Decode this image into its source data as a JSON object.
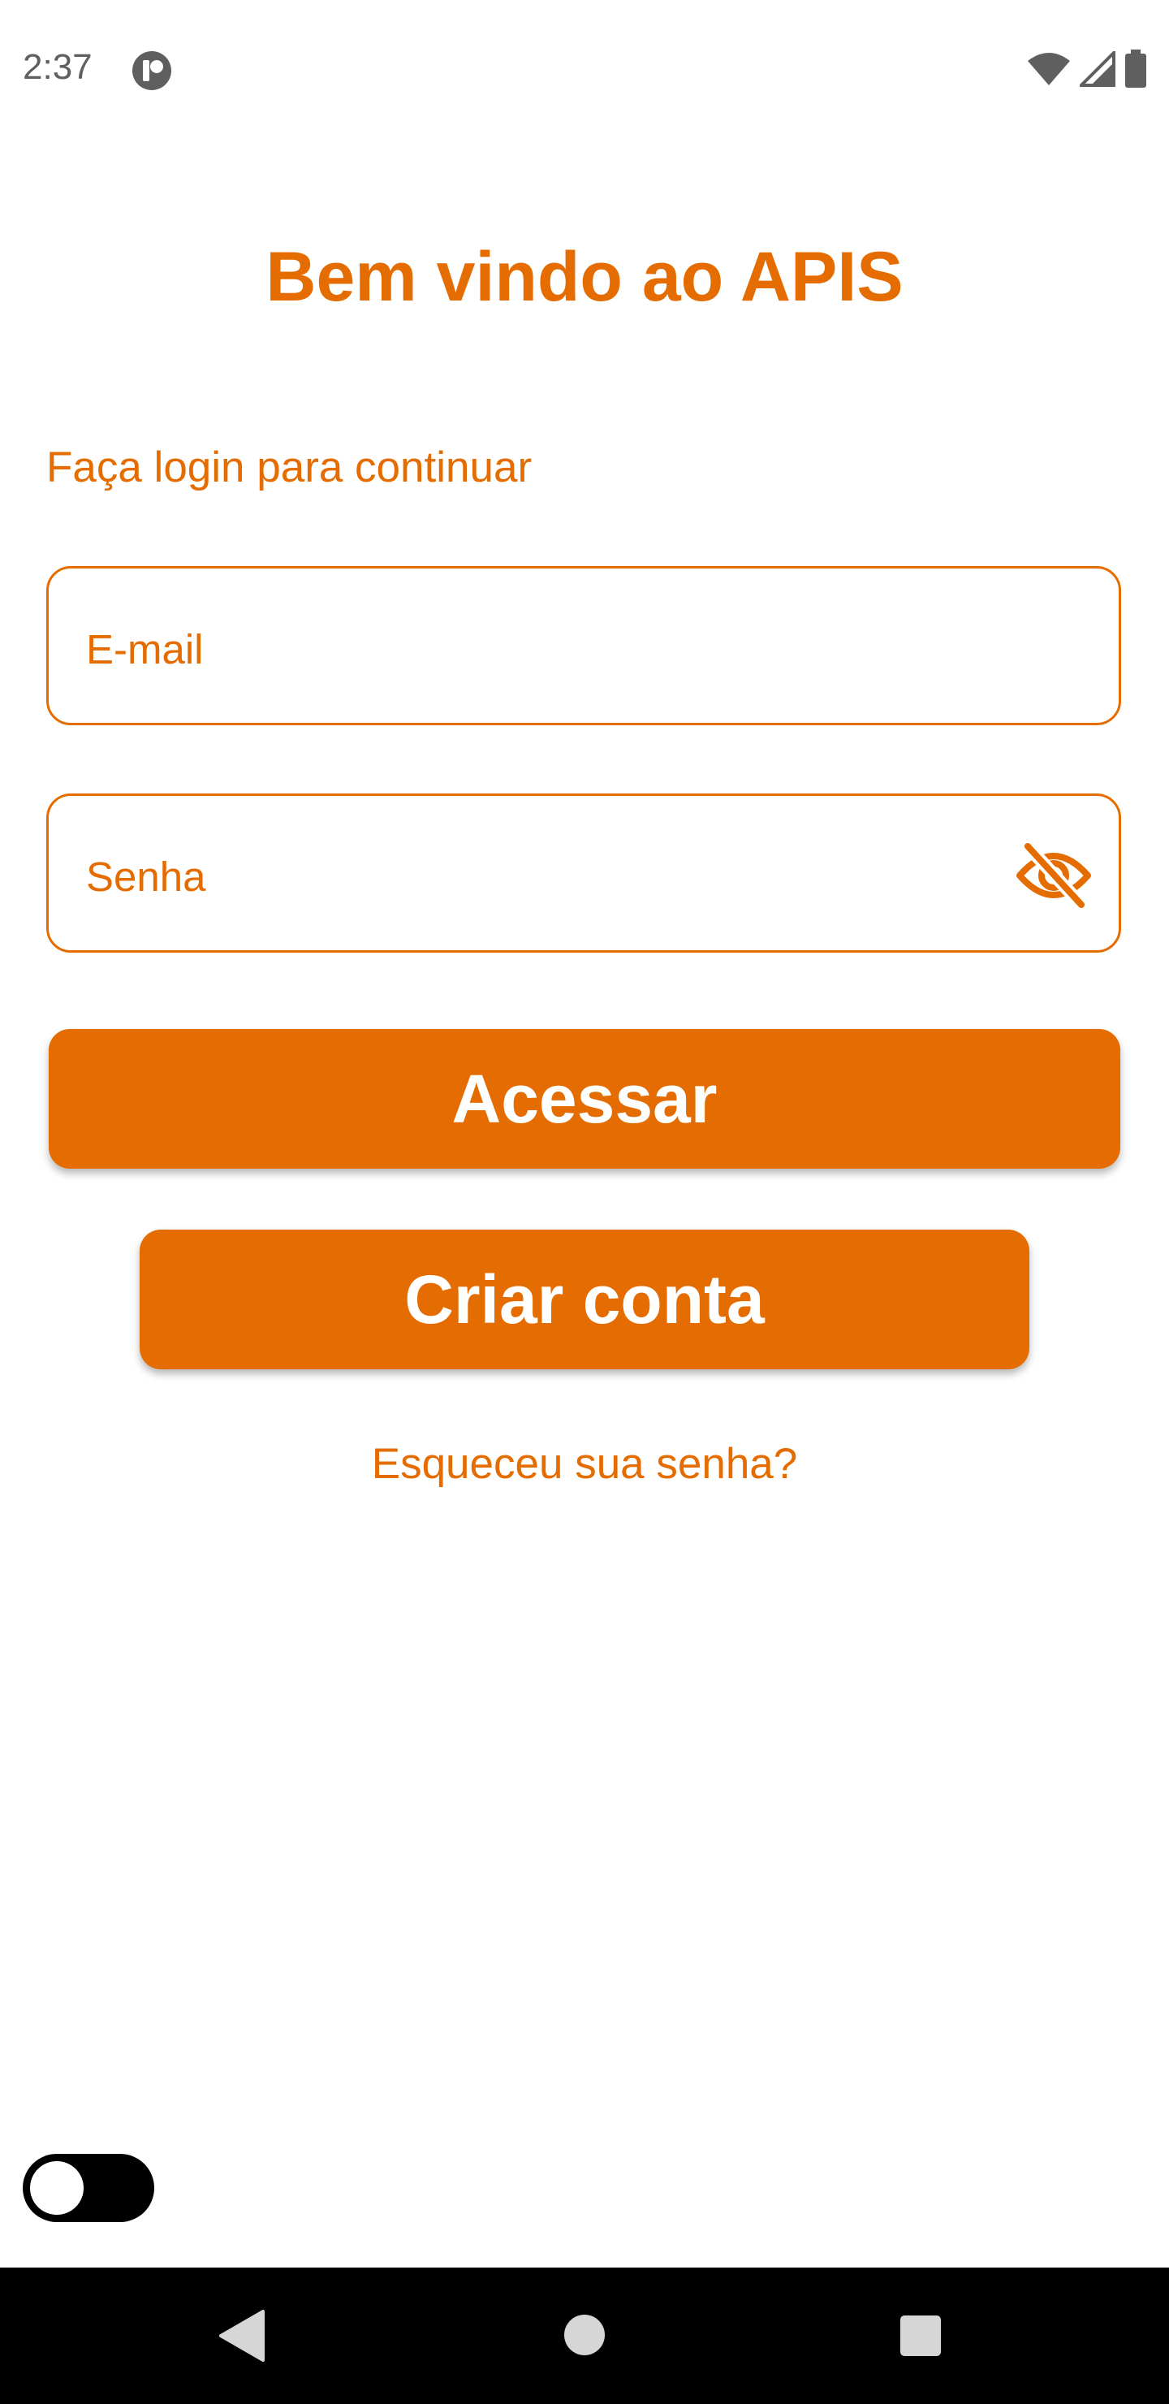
{
  "status_bar": {
    "time": "2:37",
    "icons": [
      "app-notification-icon",
      "wifi-icon",
      "cellular-signal-icon",
      "battery-icon"
    ]
  },
  "header": {
    "title": "Bem vindo ao APIS"
  },
  "login": {
    "subtitle": "Faça login para continuar",
    "email_placeholder": "E-mail",
    "password_placeholder": "Senha",
    "password_toggle_icon": "eye-off-icon",
    "login_button_label": "Acessar",
    "signup_button_label": "Criar conta",
    "forgot_password_label": "Esqueceu sua senha?"
  },
  "theme_toggle": {
    "state": "off"
  },
  "nav_bar": {
    "icons": [
      "back-icon",
      "home-icon",
      "recents-icon"
    ]
  },
  "colors": {
    "accent": "#E56C00",
    "background": "#FFFFFF",
    "button_text": "#FFFFFF",
    "nav_bar": "#000000"
  }
}
